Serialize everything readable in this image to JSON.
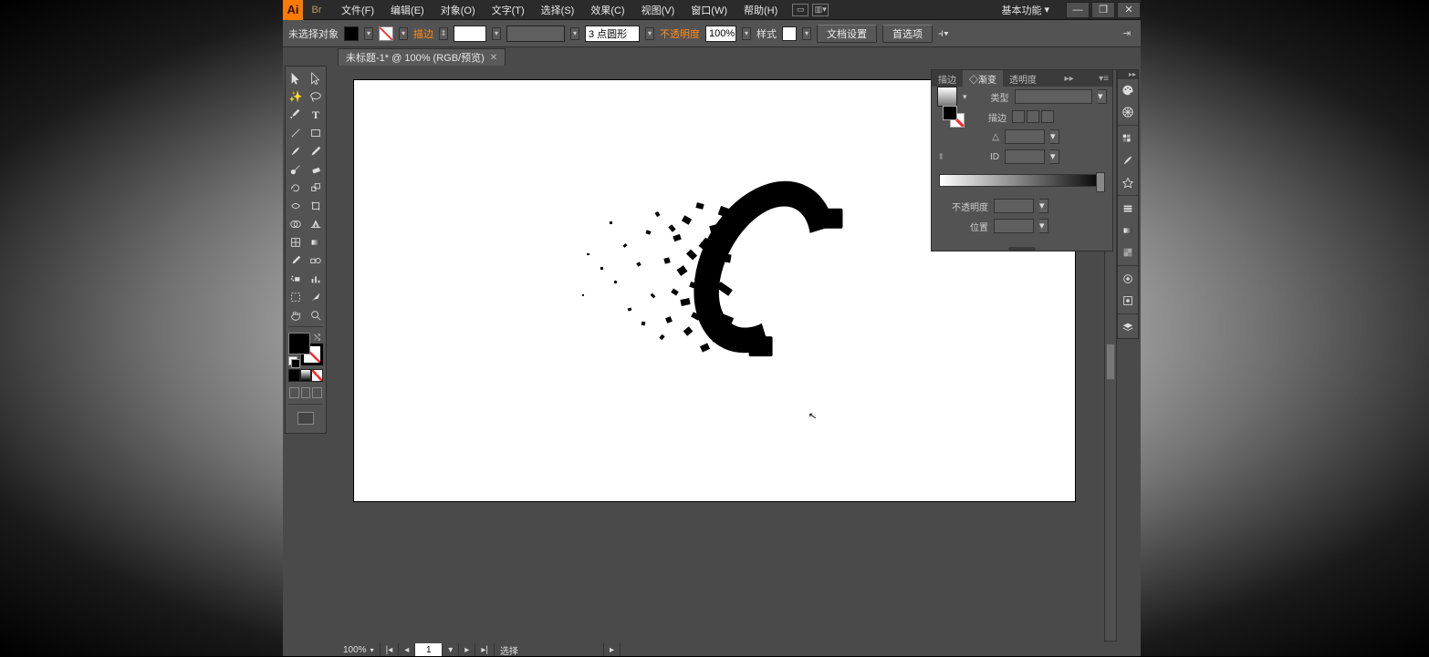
{
  "app": {
    "logo_text": "Ai",
    "workspace": "基本功能"
  },
  "menus": {
    "file": "文件(F)",
    "edit": "编辑(E)",
    "object": "对象(O)",
    "type": "文字(T)",
    "select": "选择(S)",
    "effect": "效果(C)",
    "view": "视图(V)",
    "window": "窗口(W)",
    "help": "帮助(H)"
  },
  "controlbar": {
    "selection_state": "未选择对象",
    "stroke_label": "描边",
    "stroke_input": "3 点圆形",
    "opacity_label": "不透明度",
    "opacity_value": "100%",
    "style_label": "样式",
    "doc_setup": "文档设置",
    "preferences": "首选项"
  },
  "doc": {
    "tab_title": "未标题-1* @ 100% (RGB/预览)"
  },
  "gradient_panel": {
    "tabs": {
      "stroke": "描边",
      "gradient": "◇渐变",
      "transparency": "透明度"
    },
    "type_label": "类型",
    "stroke_label": "描边",
    "angle_label": "△",
    "ratio_label": "ID",
    "opacity_label": "不透明度",
    "location_label": "位置"
  },
  "status": {
    "zoom": "100%",
    "artboard_nav": "1",
    "tool": "选择"
  },
  "colors": {
    "accent": "#ff7b00",
    "panel": "#535353",
    "warn": "#ff8c1a"
  }
}
